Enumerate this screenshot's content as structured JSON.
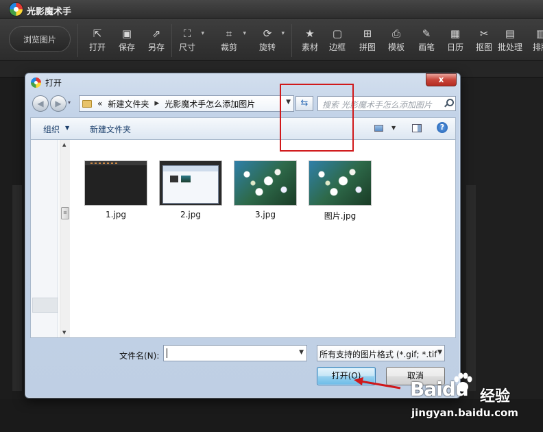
{
  "app": {
    "title": "光影魔术手",
    "browse_label": "浏览图片"
  },
  "toolbar": [
    {
      "label": "打开",
      "icon": "open-icon",
      "glyph": "⇱",
      "caret": false
    },
    {
      "label": "保存",
      "icon": "save-icon",
      "glyph": "▣",
      "caret": false
    },
    {
      "label": "另存",
      "icon": "save-as-icon",
      "glyph": "⇗",
      "caret": false
    },
    {
      "label": "尺寸",
      "icon": "resize-icon",
      "glyph": "⛶",
      "caret": true
    },
    {
      "label": "裁剪",
      "icon": "crop-icon",
      "glyph": "⌗",
      "caret": true
    },
    {
      "label": "旋转",
      "icon": "rotate-icon",
      "glyph": "⟳",
      "caret": true
    },
    {
      "label": "素材",
      "icon": "material-icon",
      "glyph": "★",
      "caret": false
    },
    {
      "label": "边框",
      "icon": "border-icon",
      "glyph": "▢",
      "caret": false
    },
    {
      "label": "拼图",
      "icon": "collage-icon",
      "glyph": "⊞",
      "caret": false
    },
    {
      "label": "模板",
      "icon": "template-icon",
      "glyph": "⎙",
      "caret": false
    },
    {
      "label": "画笔",
      "icon": "brush-icon",
      "glyph": "✎",
      "caret": false
    },
    {
      "label": "日历",
      "icon": "calendar-icon",
      "glyph": "▦",
      "caret": false
    },
    {
      "label": "抠图",
      "icon": "cutout-icon",
      "glyph": "✂",
      "caret": false
    },
    {
      "label": "批处理",
      "icon": "batch-icon",
      "glyph": "▤",
      "caret": false
    },
    {
      "label": "排版",
      "icon": "layout-icon",
      "glyph": "▥",
      "caret": false
    }
  ],
  "dialog": {
    "title": "打开",
    "close_glyph": "x",
    "breadcrumb": [
      "新建文件夹",
      "光影魔术手怎么添加图片"
    ],
    "history_glyph": "«",
    "search_placeholder": "搜索 光影魔术手怎么添加图片",
    "organize_label": "组织",
    "new_folder_label": "新建文件夹",
    "help_glyph": "?",
    "files": [
      {
        "name": "1.jpg",
        "kind": "dark"
      },
      {
        "name": "2.jpg",
        "kind": "shot"
      },
      {
        "name": "3.jpg",
        "kind": "photo"
      },
      {
        "name": "图片.jpg",
        "kind": "photo",
        "selected": true
      }
    ],
    "filename_label": "文件名(N):",
    "filename_value": "",
    "filetype_value": "所有支持的图片格式 (*.gif; *.tif",
    "open_label": "打开(O)",
    "cancel_label": "取消"
  },
  "watermark": {
    "brand": "Baidu",
    "suffix": "经验",
    "url": "jingyan.baidu.com"
  },
  "colors": {
    "selection": "#d0181a",
    "arrow": "#d0181a"
  }
}
